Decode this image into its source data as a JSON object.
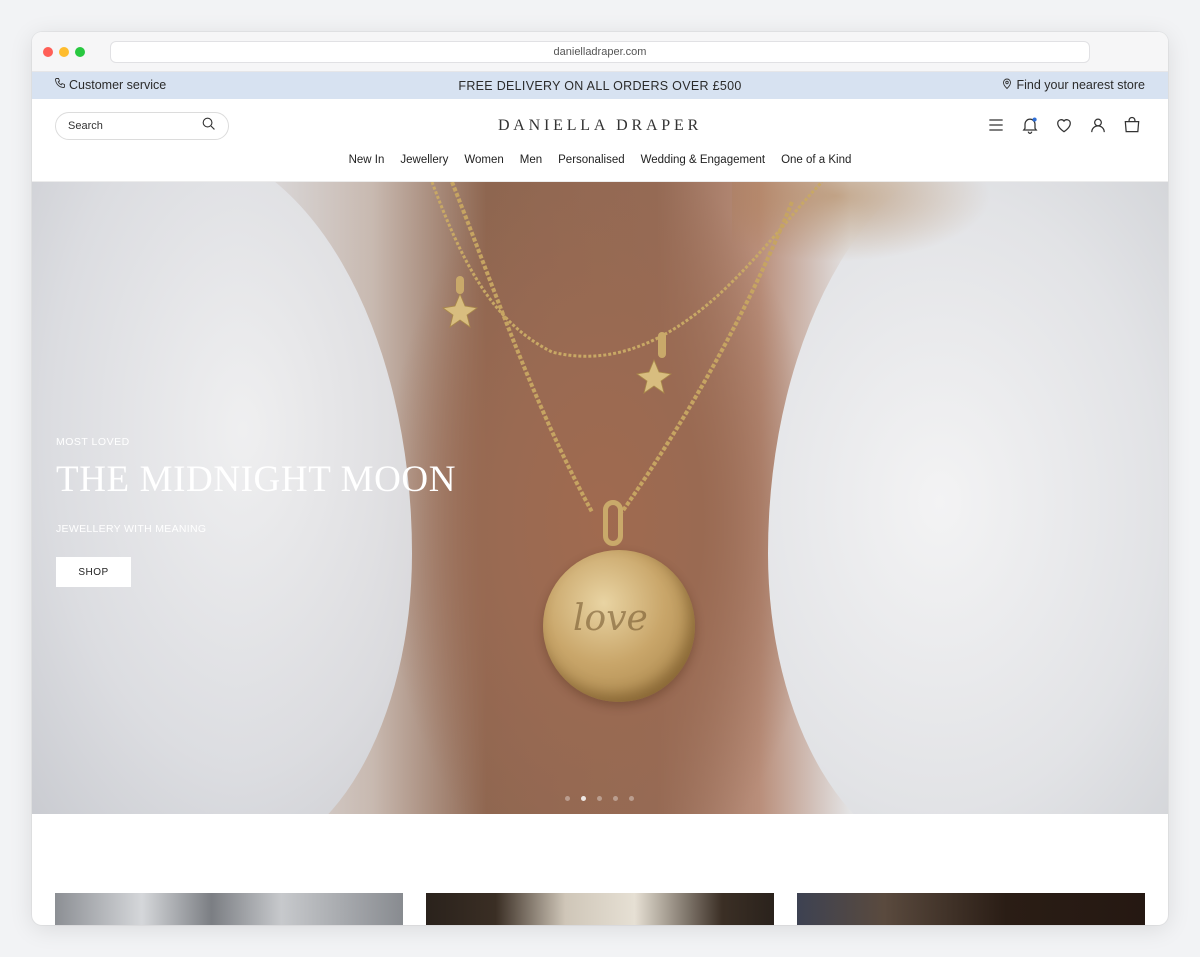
{
  "browser": {
    "url": "danielladraper.com"
  },
  "promo_bar": {
    "customer_service": "Customer service",
    "message": "FREE DELIVERY ON ALL ORDERS OVER £500",
    "store_locator": "Find your nearest store",
    "background_color": "#d7e2f1"
  },
  "header": {
    "search_placeholder": "Search",
    "logo": "DANIELLA DRAPER",
    "icons": [
      "menu-icon",
      "notification-bell-icon",
      "wishlist-heart-icon",
      "account-icon",
      "shopping-bag-icon"
    ],
    "notification_dot_color": "#2f6fd6"
  },
  "nav": {
    "items": [
      "New In",
      "Jewellery",
      "Women",
      "Men",
      "Personalised",
      "Wedding & Engagement",
      "One of a Kind"
    ]
  },
  "hero": {
    "kicker": "MOST LOVED",
    "headline": "THE MIDNIGHT MOON",
    "subheading": "JEWELLERY WITH MEANING",
    "cta": "SHOP",
    "pendant_engraving": "love",
    "slide_count": 5,
    "active_slide": 2
  }
}
